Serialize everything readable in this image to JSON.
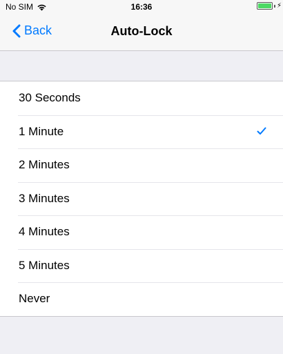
{
  "status_bar": {
    "carrier": "No SIM",
    "time": "16:36",
    "battery_color": "#4cd964",
    "wifi_icon": "wifi-icon",
    "charging_icon": "charging-bolt-icon"
  },
  "nav": {
    "back_label": "Back",
    "title": "Auto-Lock",
    "accent_color": "#007aff"
  },
  "options": [
    {
      "label": "30 Seconds",
      "selected": false
    },
    {
      "label": "1 Minute",
      "selected": true
    },
    {
      "label": "2 Minutes",
      "selected": false
    },
    {
      "label": "3 Minutes",
      "selected": false
    },
    {
      "label": "4 Minutes",
      "selected": false
    },
    {
      "label": "5 Minutes",
      "selected": false
    },
    {
      "label": "Never",
      "selected": false
    }
  ]
}
